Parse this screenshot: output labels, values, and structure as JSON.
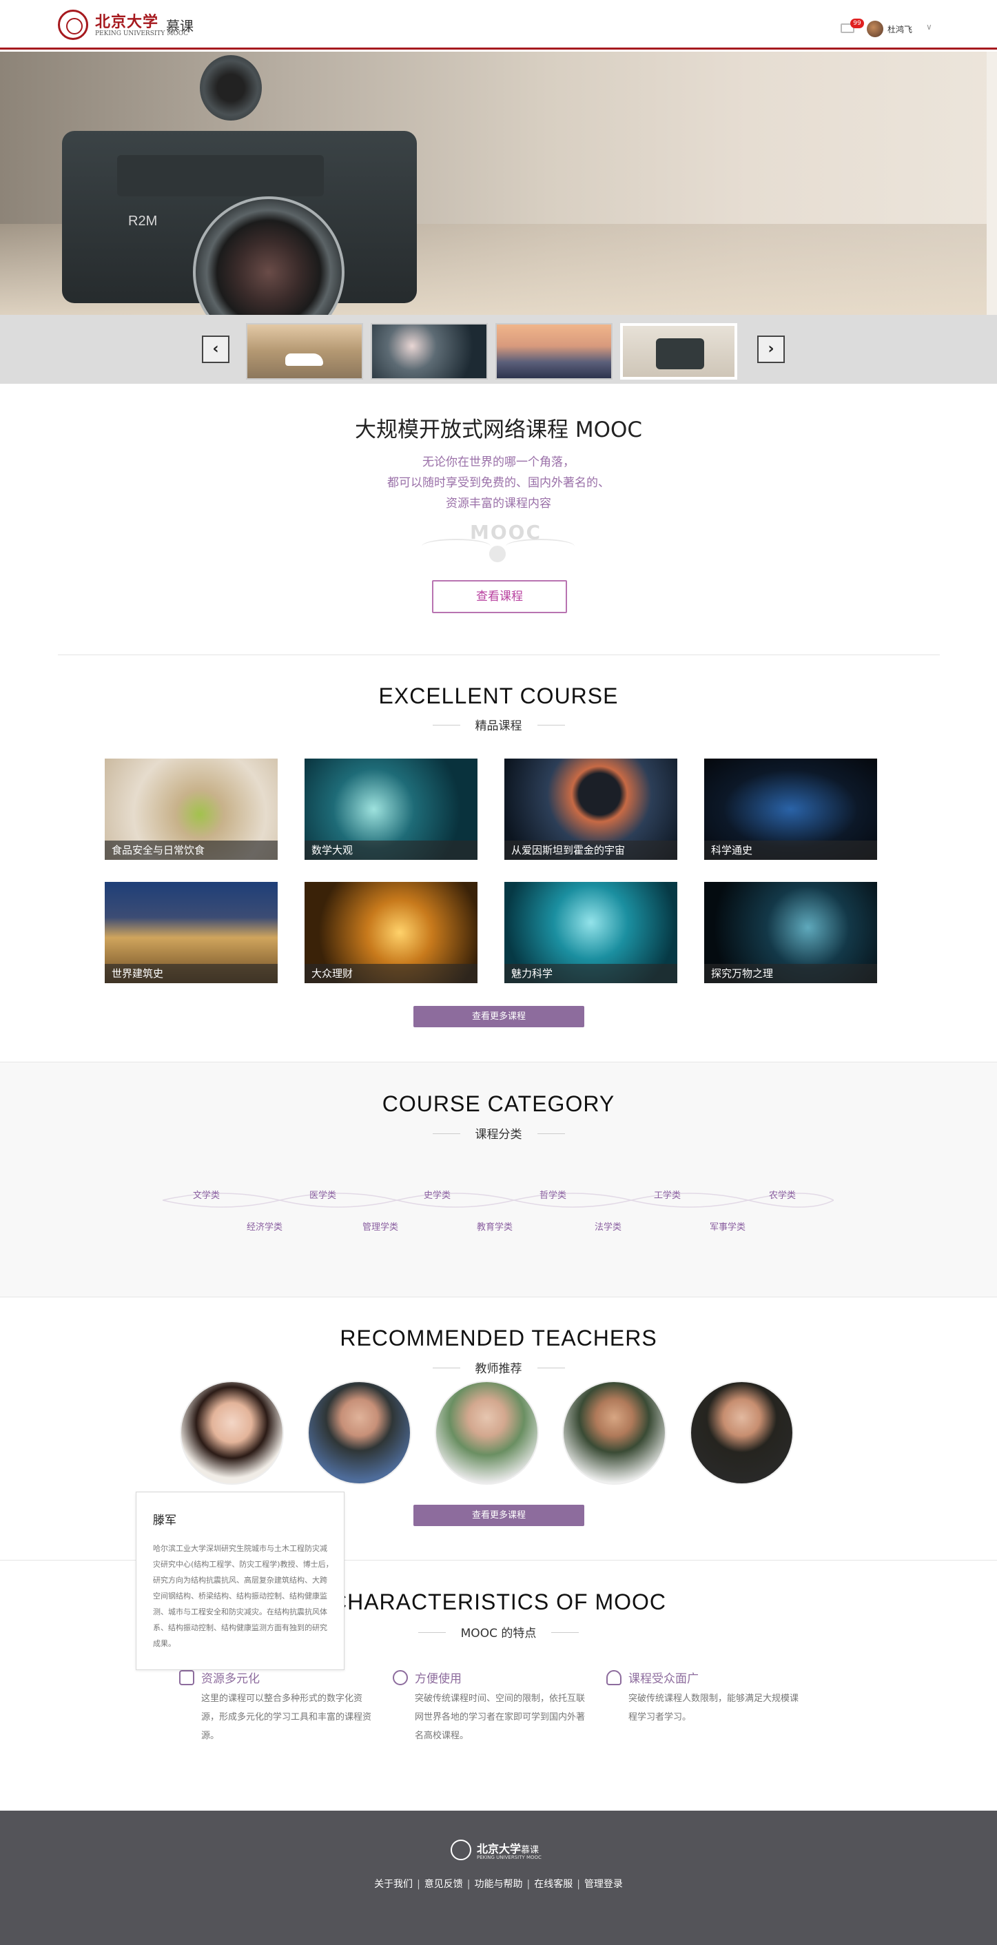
{
  "header": {
    "logo_name": "北京大学",
    "logo_suffix": "慕课",
    "logo_sub": "PEKING UNIVERSITY MOOC",
    "message_count": "99",
    "user_name": "杜鸿飞",
    "caret": "∨"
  },
  "banner": {
    "camera_label": "R2M",
    "prev_icon": "chevron-left-icon",
    "next_icon": "chevron-right-icon",
    "prev_label": "‹",
    "next_label": "›",
    "active_thumb": 4
  },
  "intro": {
    "title": "大规模开放式网络课程 MOOC",
    "lines": [
      "无论你在世界的哪一个角落，",
      "都可以随时享受到免费的、国内外著名的、",
      "资源丰富的课程内容"
    ],
    "emblem_text": "MOOC",
    "button": "查看课程"
  },
  "excellent": {
    "title": "EXCELLENT COURSE",
    "subtitle": "精品课程",
    "courses": [
      "食品安全与日常饮食",
      "数学大观",
      "从爱因斯坦到霍金的宇宙",
      "科学通史",
      "世界建筑史",
      "大众理财",
      "魅力科学",
      "探究万物之理"
    ],
    "more_button": "查看更多课程"
  },
  "category": {
    "title": "COURSE CATEGORY",
    "subtitle": "课程分类",
    "top_row": [
      "文学类",
      "医学类",
      "史学类",
      "哲学类",
      "工学类",
      "农学类"
    ],
    "bottom_row": [
      "经济学类",
      "管理学类",
      "教育学类",
      "法学类",
      "军事学类"
    ]
  },
  "teachers": {
    "title": "RECOMMENDED TEACHERS",
    "subtitle": "教师推荐",
    "more_button": "查看更多课程",
    "popup": {
      "name": "滕军",
      "description": "哈尔滨工业大学深圳研究生院城市与土木工程防灾减灾研究中心(结构工程学、防灾工程学)教授、博士后，研究方向为结构抗震抗风、高层复杂建筑结构、大跨空间钢结构、桥梁结构、结构振动控制、结构健康监测、城市与工程安全和防灾减灾。在结构抗震抗风体系、结构振动控制、结构健康监测方面有独到的研究成果。"
    }
  },
  "characteristics": {
    "title": "CHARACTERISTICS OF MOOC",
    "subtitle": "MOOC 的特点",
    "items": [
      {
        "title": "资源多元化",
        "text": "这里的课程可以整合多种形式的数字化资源，形成多元化的学习工具和丰富的课程资源。",
        "icon": "resource-icon"
      },
      {
        "title": "方便使用",
        "text": "突破传统课程时间、空间的限制，依托互联网世界各地的学习者在家即可学到国内外著名高校课程。",
        "icon": "globe-icon"
      },
      {
        "title": "课程受众面广",
        "text": "突破传统课程人数限制，能够满足大规模课程学习者学习。",
        "icon": "user-icon"
      }
    ]
  },
  "footer": {
    "logo_name": "北京大学",
    "logo_suffix": "慕课",
    "logo_sub": "PEKING UNIVERSITY MOOC",
    "links": [
      "关于我们",
      "意见反馈",
      "功能与帮助",
      "在线客服",
      "管理登录"
    ],
    "separator": "|"
  },
  "colors": {
    "brand_red": "#a6191e",
    "accent_purple": "#8d6c9d",
    "footer_bg": "#545459"
  }
}
